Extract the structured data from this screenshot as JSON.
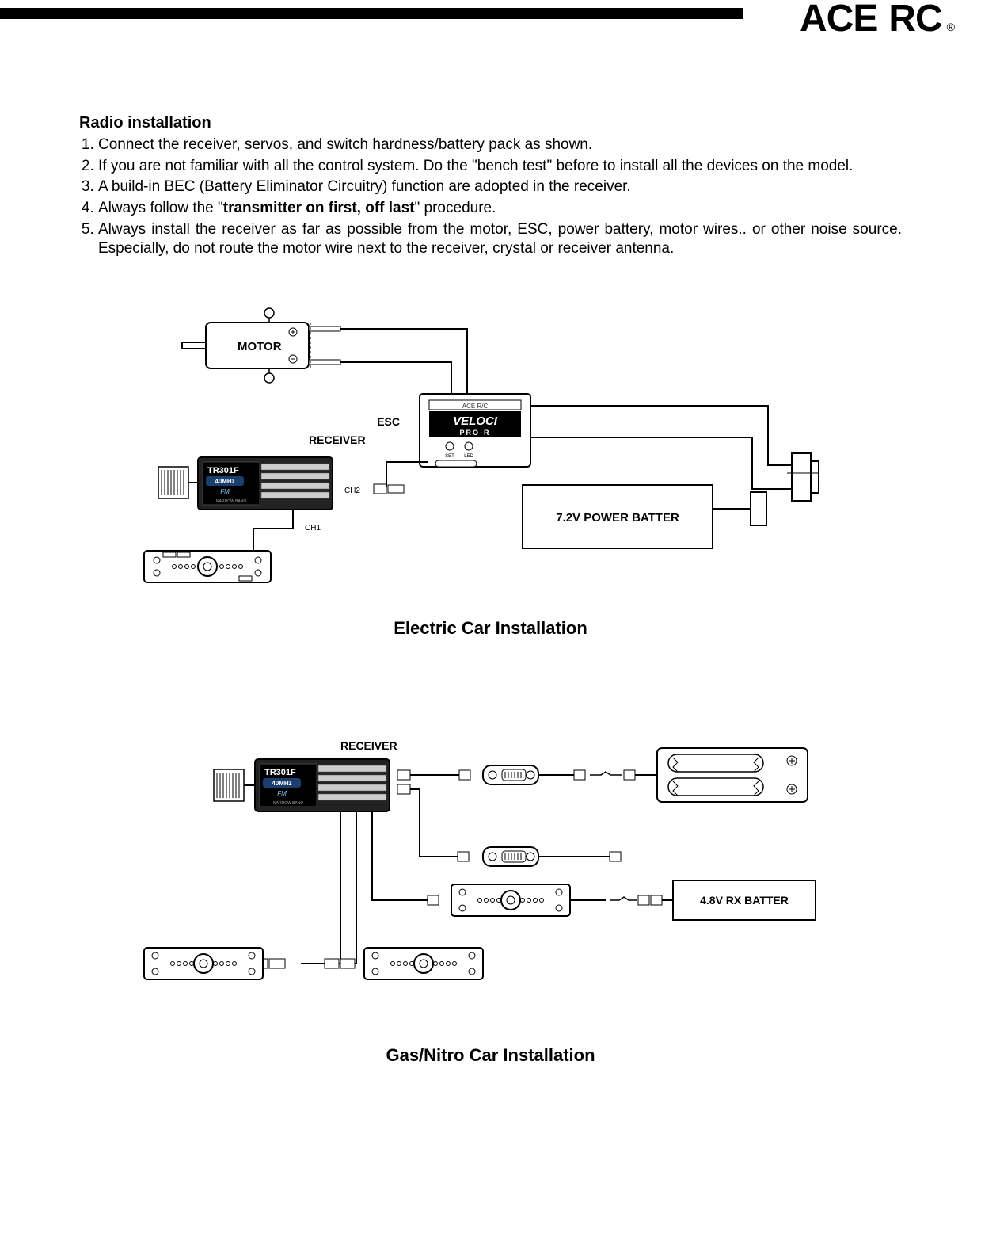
{
  "brand": {
    "name_part1": "ACE",
    "name_part2": "RC",
    "registered": "®"
  },
  "section": {
    "title": "Radio installation",
    "steps": [
      "Connect the receiver, servos, and switch hardness/battery pack as shown.",
      "If you are not familiar with all the control system. Do the \"bench test\" before to install all the devices on the model.",
      "A build-in BEC (Battery Eliminator Circuitry) function are adopted in the receiver.",
      "Always follow the \"<b>transmitter on first, off last</b>\" procedure.",
      "Always install the receiver as far as possible from the motor, ESC, power battery, motor wires.. or other noise source. Especially, do not route the motor wire next to the receiver, crystal or receiver antenna."
    ]
  },
  "diagram1": {
    "caption": "Electric Car Installation",
    "labels": {
      "motor": "MOTOR",
      "esc": "ESC",
      "receiver": "RECEIVER",
      "ch1": "CH1",
      "ch2": "CH2",
      "battery": "7.2V POWER BATTER",
      "esc_brand_small": "ACE R/C",
      "esc_model": "VELOCI",
      "esc_sub": "PRO-R",
      "esc_set": "SET",
      "esc_led": "LED",
      "rx_model": "TR301F",
      "rx_freq": "40MHz",
      "rx_mode": "FM",
      "rx_band": "NARROW BAND"
    }
  },
  "diagram2": {
    "caption": "Gas/Nitro Car Installation",
    "labels": {
      "receiver": "RECEIVER",
      "battery": "4.8V RX BATTER",
      "rx_model": "TR301F",
      "rx_freq": "40MHz",
      "rx_mode": "FM",
      "rx_band": "NARROW BAND"
    }
  }
}
